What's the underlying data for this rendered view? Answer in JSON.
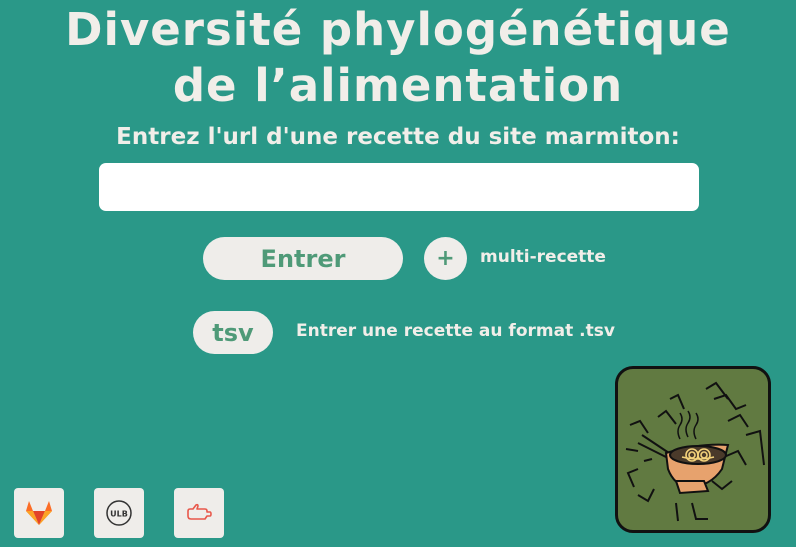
{
  "header": {
    "title_line1": "Diversité phylogénétique",
    "title_line2": "de l’alimentation"
  },
  "form": {
    "prompt": "Entrez l'url d'une recette du site marmiton:",
    "url_value": "",
    "enter_label": "Entrer",
    "plus_label": "+",
    "multi_label": "multi-recette",
    "tsv_label": "tsv",
    "tsv_description": "Entrer une recette au format .tsv"
  },
  "footer": {
    "icons": [
      "gitlab-icon",
      "ulb-icon",
      "hand-pointer-icon"
    ],
    "ulb_text": "ULB"
  },
  "logo": {
    "icon": "noodle-bowl-icon",
    "bowl_color": "#e7a26d",
    "background_color": "#617a41"
  },
  "colors": {
    "background": "#2a9888",
    "button_bg": "#efedea",
    "button_text": "#4f9a78"
  }
}
